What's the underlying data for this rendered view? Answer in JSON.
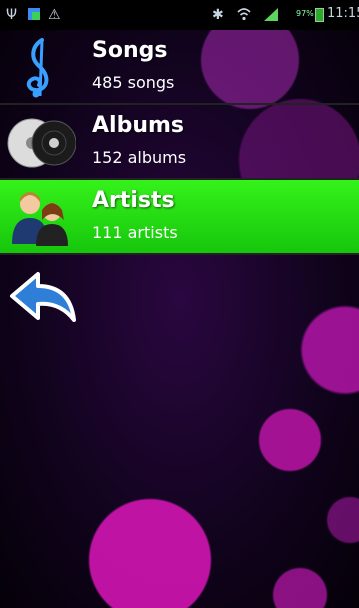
{
  "status_bar": {
    "battery_text": "97%",
    "time": "11:15",
    "icons": [
      "usb-icon",
      "app-icon",
      "warning-icon",
      "bluetooth-icon",
      "wifi-icon",
      "signal-icon",
      "battery-icon"
    ]
  },
  "menu": {
    "items": [
      {
        "label": "Songs",
        "count_text": "485 songs",
        "icon": "treble-clef-icon",
        "selected": false
      },
      {
        "label": "Albums",
        "count_text": "152 albums",
        "icon": "discs-icon",
        "selected": false
      },
      {
        "label": "Artists",
        "count_text": "111 artists",
        "icon": "artists-icon",
        "selected": true
      }
    ]
  },
  "colors": {
    "selected_row": "#22dd14",
    "background_bokeh": "#c81aaa",
    "background_dark": "#10031c"
  }
}
